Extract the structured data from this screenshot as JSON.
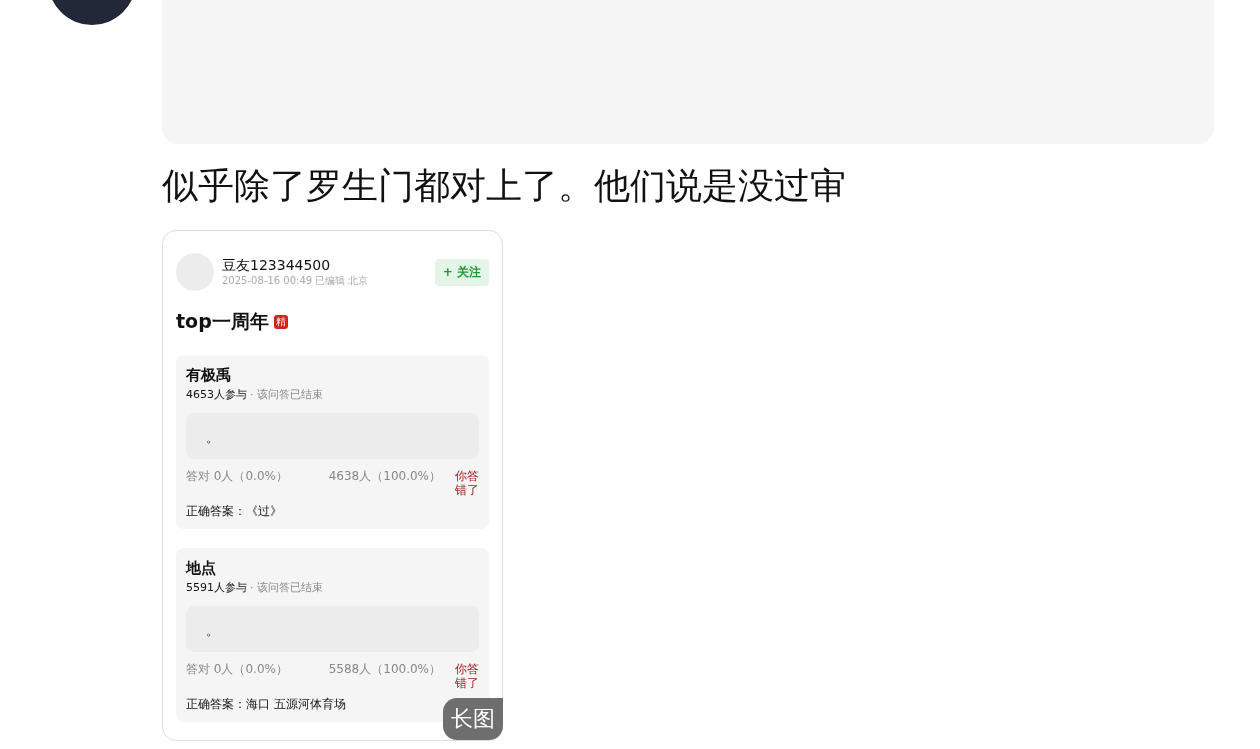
{
  "post": {
    "text": "似乎除了罗生门都对上了。他们说是没过审"
  },
  "card": {
    "author": "豆友123344500",
    "meta": "2025-08-16 00:49  已编辑  北京",
    "follow_button": "+ 关注",
    "title": "top一周年",
    "title_badge": "精",
    "questions": [
      {
        "title": "有极禹",
        "participants": "4653人参与",
        "status": "· 该问答已结束",
        "option": "。",
        "correct_count": "答对  0人（0.0%）",
        "wrong_count": "4638人（100.0%）",
        "your_result": "你答错了",
        "answer_label": "正确答案：",
        "answer": "《过》"
      },
      {
        "title": "地点",
        "participants": "5591人参与",
        "status": "· 该问答已结束",
        "option": "。",
        "correct_count": "答对  0人（0.0%）",
        "wrong_count": "5588人（100.0%）",
        "your_result": "你答错了",
        "answer_label": "正确答案：",
        "answer": "海口 五源河体育场"
      }
    ]
  },
  "image_badge": "长图"
}
